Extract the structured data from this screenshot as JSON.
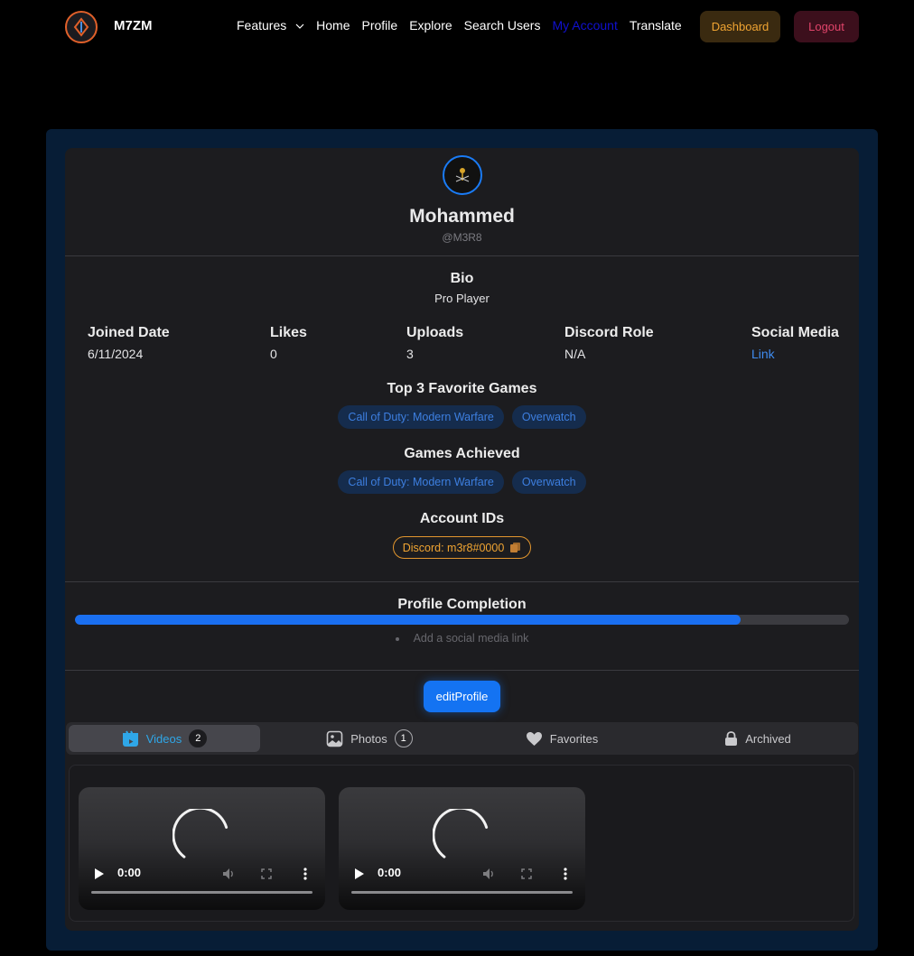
{
  "nav": {
    "brand": "M7ZM",
    "links": [
      "Features",
      "Home",
      "Profile",
      "Explore",
      "Search Users",
      "My Account",
      "Translate"
    ],
    "active_link": "My Account",
    "dashboard_label": "Dashboard",
    "logout_label": "Logout"
  },
  "profile": {
    "name": "Mohammed",
    "handle": "@M3R8",
    "bio_heading": "Bio",
    "bio": "Pro Player",
    "stats": [
      {
        "label": "Joined Date",
        "value": "6/11/2024"
      },
      {
        "label": "Likes",
        "value": "0"
      },
      {
        "label": "Uploads",
        "value": "3"
      },
      {
        "label": "Discord Role",
        "value": "N/A"
      },
      {
        "label": "Social Media",
        "value": "Link"
      }
    ],
    "favorite_games_heading": "Top 3 Favorite Games",
    "favorite_games": [
      "Call of Duty: Modern Warfare",
      "Overwatch"
    ],
    "games_achieved_heading": "Games Achieved",
    "games_achieved": [
      "Call of Duty: Modern Warfare",
      "Overwatch"
    ],
    "account_ids_heading": "Account IDs",
    "account_id": "Discord: m3r8#0000"
  },
  "completion": {
    "heading": "Profile Completion",
    "percent": 86,
    "hint": "Add a social media link"
  },
  "edit_button": "editProfile",
  "tabs": [
    {
      "label": "Videos",
      "count": "2",
      "icon": "video-icon"
    },
    {
      "label": "Photos",
      "count": "1",
      "icon": "photo-icon"
    },
    {
      "label": "Favorites",
      "icon": "heart-icon"
    },
    {
      "label": "Archived",
      "icon": "lock-icon"
    }
  ],
  "videos": [
    {
      "time": "0:00"
    },
    {
      "time": "0:00"
    }
  ],
  "colors": {
    "accent": "#1473f2",
    "dashboard": "#f0a432",
    "logout": "#e0446a",
    "tag_text": "#3d7fe0"
  }
}
